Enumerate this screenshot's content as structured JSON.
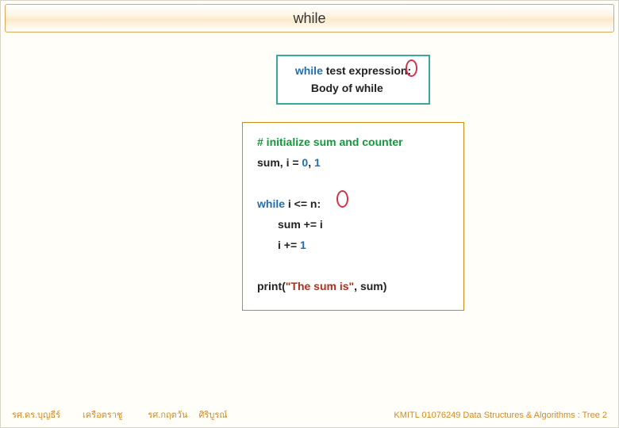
{
  "title": "while",
  "syntax": {
    "keyword": "while",
    "rest": " test expression",
    "colon": ":",
    "body": "Body of while"
  },
  "code": {
    "l1_comment": "# initialize sum and counter",
    "l2_a": "sum, i = ",
    "l2_n1": "0",
    "l2_c": ", ",
    "l2_n2": "1",
    "l3_kw": "while",
    "l3_rest": " i <= n",
    "l3_colon": ":",
    "l4": "sum += i",
    "l5": "i += ",
    "l5_n": "1",
    "l6_a": "print(",
    "l6_str": "\"The sum is\"",
    "l6_b": ", sum)"
  },
  "footer": {
    "left1a": "รศ.ดร.บุญธีร์",
    "left1b": "เครือตราชู",
    "left2a": "รศ.กฤตวัน",
    "left2b": "ศิริบูรณ์",
    "right": "KMITL   01076249 Data Structures & Algorithms : Tree 2"
  }
}
